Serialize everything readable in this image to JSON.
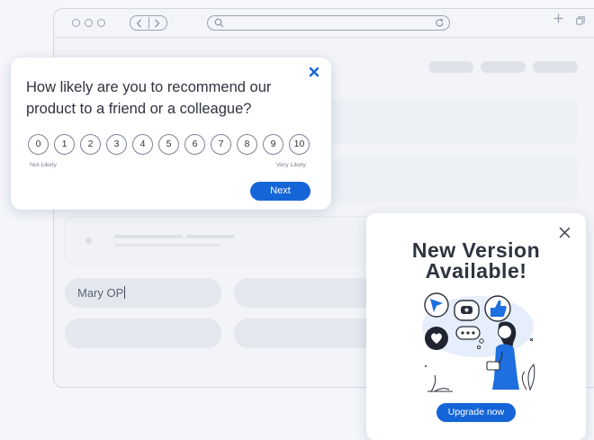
{
  "form": {
    "name_value": "Mary OP"
  },
  "survey": {
    "question_line1": "How likely are you to recommend our",
    "question_line2": "product to a friend or a colleague?",
    "scale": [
      "0",
      "1",
      "2",
      "3",
      "4",
      "5",
      "6",
      "7",
      "8",
      "9",
      "10"
    ],
    "low_label": "Not Likely",
    "high_label": "Very Likely",
    "next_label": "Next"
  },
  "popup": {
    "title_line1": "New Version",
    "title_line2": "Available!",
    "upgrade_label": "Upgrade now"
  },
  "colors": {
    "accent": "#1565d8",
    "text_dark": "#2e3340",
    "background": "#f4f6fa"
  },
  "icons": [
    "close-icon",
    "search-icon",
    "refresh-icon",
    "plus-icon",
    "copy-icon",
    "chevron-left-icon",
    "chevron-right-icon"
  ]
}
